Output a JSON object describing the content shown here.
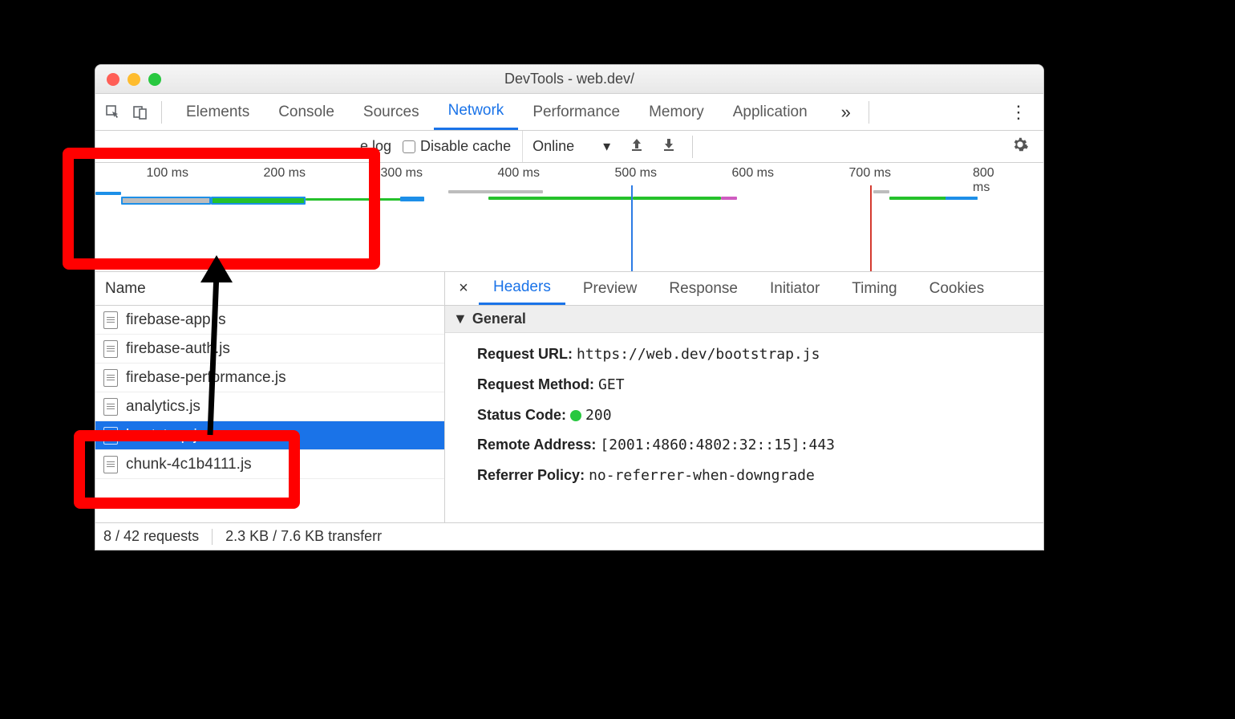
{
  "title": "DevTools - web.dev/",
  "main_tabs": [
    "Elements",
    "Console",
    "Sources",
    "Network",
    "Performance",
    "Memory",
    "Application"
  ],
  "main_tabs_active": 3,
  "filterbar": {
    "preserve_log": "e log",
    "disable_cache": "Disable cache",
    "throttling": "Online"
  },
  "timeline_ticks": [
    "100 ms",
    "200 ms",
    "300 ms",
    "400 ms",
    "500 ms",
    "600 ms",
    "700 ms",
    "800 ms"
  ],
  "name_header": "Name",
  "requests": [
    "firebase-app.js",
    "firebase-auth.js",
    "firebase-performance.js",
    "analytics.js",
    "bootstrap.js",
    "chunk-4c1b4111.js"
  ],
  "selected_request_index": 4,
  "detail_tabs": [
    "Headers",
    "Preview",
    "Response",
    "Initiator",
    "Timing",
    "Cookies"
  ],
  "detail_tabs_active": 0,
  "general_section_title": "General",
  "general": {
    "request_url_label": "Request URL:",
    "request_url": "https://web.dev/bootstrap.js",
    "request_method_label": "Request Method:",
    "request_method": "GET",
    "status_code_label": "Status Code:",
    "status_code": "200",
    "remote_address_label": "Remote Address:",
    "remote_address": "[2001:4860:4802:32::15]:443",
    "referrer_policy_label": "Referrer Policy:",
    "referrer_policy": "no-referrer-when-downgrade"
  },
  "status": {
    "requests": "8 / 42 requests",
    "transferred": "2.3 KB / 7.6 KB transferr"
  }
}
